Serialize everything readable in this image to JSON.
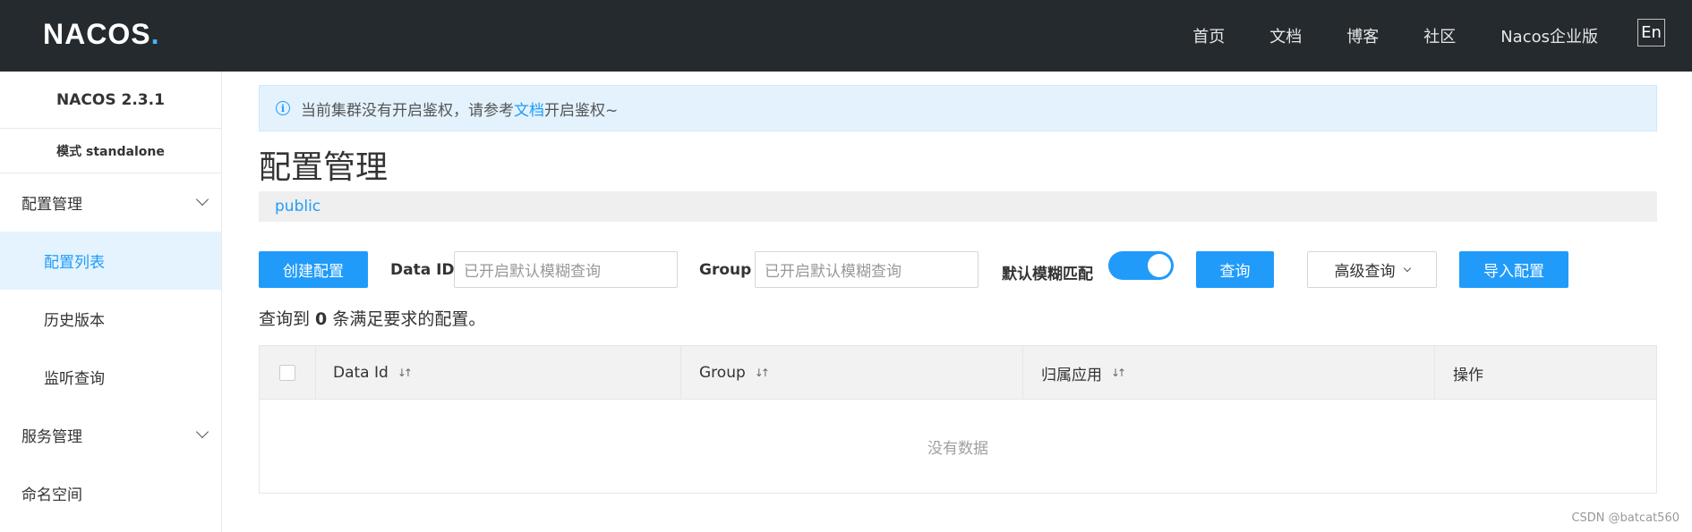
{
  "header": {
    "logo_text": "NACOS",
    "nav": [
      "首页",
      "文档",
      "博客",
      "社区",
      "Nacos企业版"
    ],
    "lang": "En"
  },
  "sidebar": {
    "version": "NACOS 2.3.1",
    "mode": "模式 standalone",
    "items": [
      {
        "label": "配置管理",
        "type": "group"
      },
      {
        "label": "配置列表",
        "type": "item",
        "active": true
      },
      {
        "label": "历史版本",
        "type": "item"
      },
      {
        "label": "监听查询",
        "type": "item"
      },
      {
        "label": "服务管理",
        "type": "group"
      },
      {
        "label": "命名空间",
        "type": "item"
      }
    ]
  },
  "main": {
    "notice_prefix": "当前集群没有开启鉴权，请参考",
    "notice_link": "文档",
    "notice_suffix": "开启鉴权~",
    "title": "配置管理",
    "namespace": "public",
    "toolbar": {
      "create_label": "创建配置",
      "dataid_label": "Data ID",
      "dataid_placeholder": "已开启默认模糊查询",
      "group_label": "Group",
      "group_placeholder": "已开启默认模糊查询",
      "fuzzy_label": "默认模糊匹配",
      "fuzzy_on": true,
      "query_label": "查询",
      "advanced_label": "高级查询",
      "import_label": "导入配置"
    },
    "summary_prefix": "查询到 ",
    "summary_count": "0",
    "summary_suffix": " 条满足要求的配置。",
    "table": {
      "columns": [
        "Data Id",
        "Group",
        "归属应用",
        "操作"
      ],
      "empty_text": "没有数据"
    }
  },
  "watermark": "CSDN @batcat560",
  "colors": {
    "primary": "#209bfa",
    "header_bg": "#252a2f",
    "notice_bg": "#e3f2fd"
  }
}
